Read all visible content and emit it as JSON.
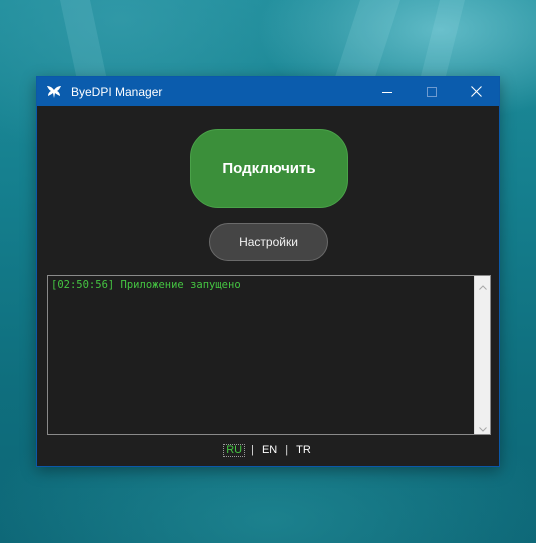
{
  "window": {
    "title": "ByeDPI Manager",
    "icons": {
      "app": "bird-icon",
      "minimize": "minimize-icon",
      "maximize": "maximize-icon",
      "close": "close-icon"
    },
    "colors": {
      "titlebar": "#0b5cad",
      "background": "#1f1f1f",
      "connect_button": "#3b8f3a",
      "log_text": "#45c542"
    }
  },
  "main": {
    "connect_label": "Подключить",
    "settings_label": "Настройки"
  },
  "log": {
    "lines": [
      "[02:50:56] Приложение запущено"
    ]
  },
  "languages": {
    "items": [
      "RU",
      "EN",
      "TR"
    ],
    "separator": "|",
    "selected": "RU"
  }
}
